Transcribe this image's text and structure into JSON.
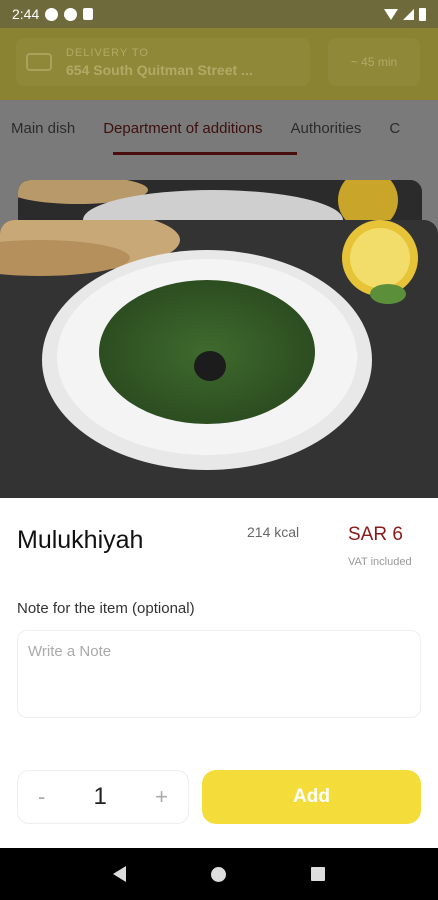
{
  "status_bar": {
    "time": "2:44"
  },
  "header": {
    "delivery_label": "DELIVERY TO",
    "delivery_address": "654 South Quitman Street ...",
    "time_estimate": "~ 45 min"
  },
  "tabs": [
    {
      "label": "Main dish"
    },
    {
      "label": "Department of additions"
    },
    {
      "label": "Authorities"
    },
    {
      "label": "C"
    }
  ],
  "item": {
    "name": "Mulukhiyah",
    "kcal": "214 kcal",
    "price": "SAR 6",
    "vat_note": "VAT included",
    "note_label": "Note for the item (optional)",
    "note_placeholder": "Write a Note",
    "note_value": ""
  },
  "quantity": {
    "minus": "-",
    "value": "1",
    "plus": "+"
  },
  "add_button": {
    "label": "Add"
  },
  "colors": {
    "accent_yellow": "#f4dc3a",
    "price_red": "#8a1a1a",
    "tab_active": "#4a0d0d"
  }
}
